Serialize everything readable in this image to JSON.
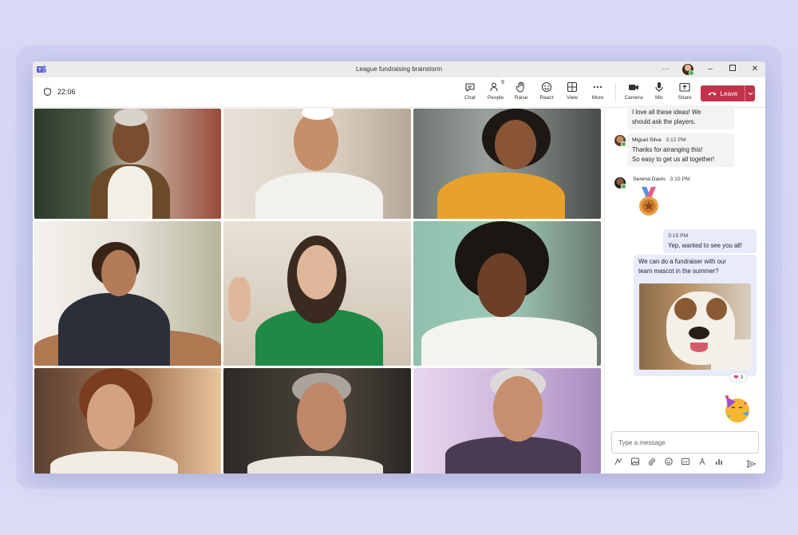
{
  "window": {
    "title": "League fundraising brainstorm"
  },
  "titlebar_icons": [
    "more-icon",
    "minimize-icon",
    "maximize-icon",
    "close-icon"
  ],
  "meeting": {
    "timer": "22:06",
    "controls": [
      {
        "label": "Chat",
        "icon": "chat-icon"
      },
      {
        "label": "People",
        "icon": "people-icon",
        "badge": "9"
      },
      {
        "label": "Raise",
        "icon": "hand-icon"
      },
      {
        "label": "React",
        "icon": "smile-icon"
      },
      {
        "label": "View",
        "icon": "grid-icon"
      },
      {
        "label": "More",
        "icon": "more-icon"
      },
      {
        "label": "Camera",
        "icon": "camera-icon"
      },
      {
        "label": "Mic",
        "icon": "mic-icon"
      },
      {
        "label": "Share",
        "icon": "share-icon"
      }
    ],
    "leave_label": "Leave"
  },
  "chat": {
    "messages": [
      {
        "type": "in",
        "text_line1": "I love all these ideas! We",
        "text_line2": "should ask the players."
      },
      {
        "type": "in",
        "author": "Miguel Silva",
        "time": "3:12 PM",
        "text_line1": "Thanks for arranging this!",
        "text_line2": "So easy to get us all together!"
      },
      {
        "type": "in",
        "author": "Serena Davis",
        "time": "3:15 PM",
        "sticker": "medal-sticker"
      },
      {
        "type": "out",
        "time": "3:15 PM",
        "text": "Yep, wanted to see you all!"
      },
      {
        "type": "out",
        "text_line1": "We can do a fundraiser with our",
        "text_line2": "team mascot in the summer?",
        "image": "bulldog-photo",
        "reaction": {
          "emoji": "heart",
          "count": "3"
        }
      },
      {
        "type": "out",
        "sticker": "party-face-emoji"
      }
    ],
    "compose_placeholder": "Type a message",
    "compose_tools": [
      "format-icon",
      "image-icon",
      "attach-icon",
      "emoji-icon",
      "gif-icon",
      "loop-icon",
      "poll-icon"
    ]
  },
  "participants_count": 9
}
